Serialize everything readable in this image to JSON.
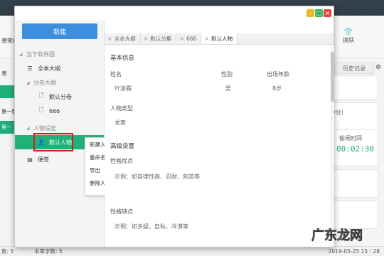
{
  "colors": {
    "accent_blue": "#3e8ee0",
    "accent_green": "#1fb178",
    "highlight_red": "#d21d1d",
    "timer_green": "#1fae7a"
  },
  "background_app": {
    "toolbar_left_text": "想笑组",
    "side_text_1": "息",
    "side_text_2": "第一卷",
    "green_tab_label": "第一",
    "right_button_skin": "换肤",
    "history_tab": "历史记录",
    "speed_text": "/分）",
    "timer_label": "偷闲时间",
    "timer_value": "00:02:30"
  },
  "status_bar": {
    "left": "数: 5",
    "word_count": "本章字数: 5",
    "datetime": "2019-05-25 15 : 28"
  },
  "dialog": {
    "new_button": "新建",
    "tree": {
      "section_outline": "当下软件园",
      "outline_item": "全本大纲",
      "section_chapter_outline": "分卷大纲",
      "chapter_item_1": "默认分卷",
      "chapter_item_2": "666",
      "section_characters": "人物设定",
      "character_item_selected": "默认人物",
      "other_item": "便签"
    },
    "context_menu": [
      "新建人物",
      "重命名",
      "导出",
      "删除人物"
    ],
    "tabs": [
      "全本大纲",
      "默认分集",
      "666",
      "默认人物"
    ],
    "content": {
      "basic_info_title": "基本信息",
      "name_label": "姓名",
      "name_value": "叶凌霜",
      "gender_label": "性别",
      "gender_value": "男",
      "age_label": "出场年龄",
      "age_value": "8岁",
      "type_label": "人物类型",
      "type_value": "龙套",
      "advanced_title": "高级设置",
      "strengths_label": "性格优点",
      "strengths_placeholder": "示例：如自律性高、忍耐、刻苦等",
      "weaknesses_label": "性格缺点",
      "weaknesses_placeholder": "示例：如多疑、自私、冷漠等"
    }
  },
  "watermark": {
    "text": "广东龙网"
  }
}
